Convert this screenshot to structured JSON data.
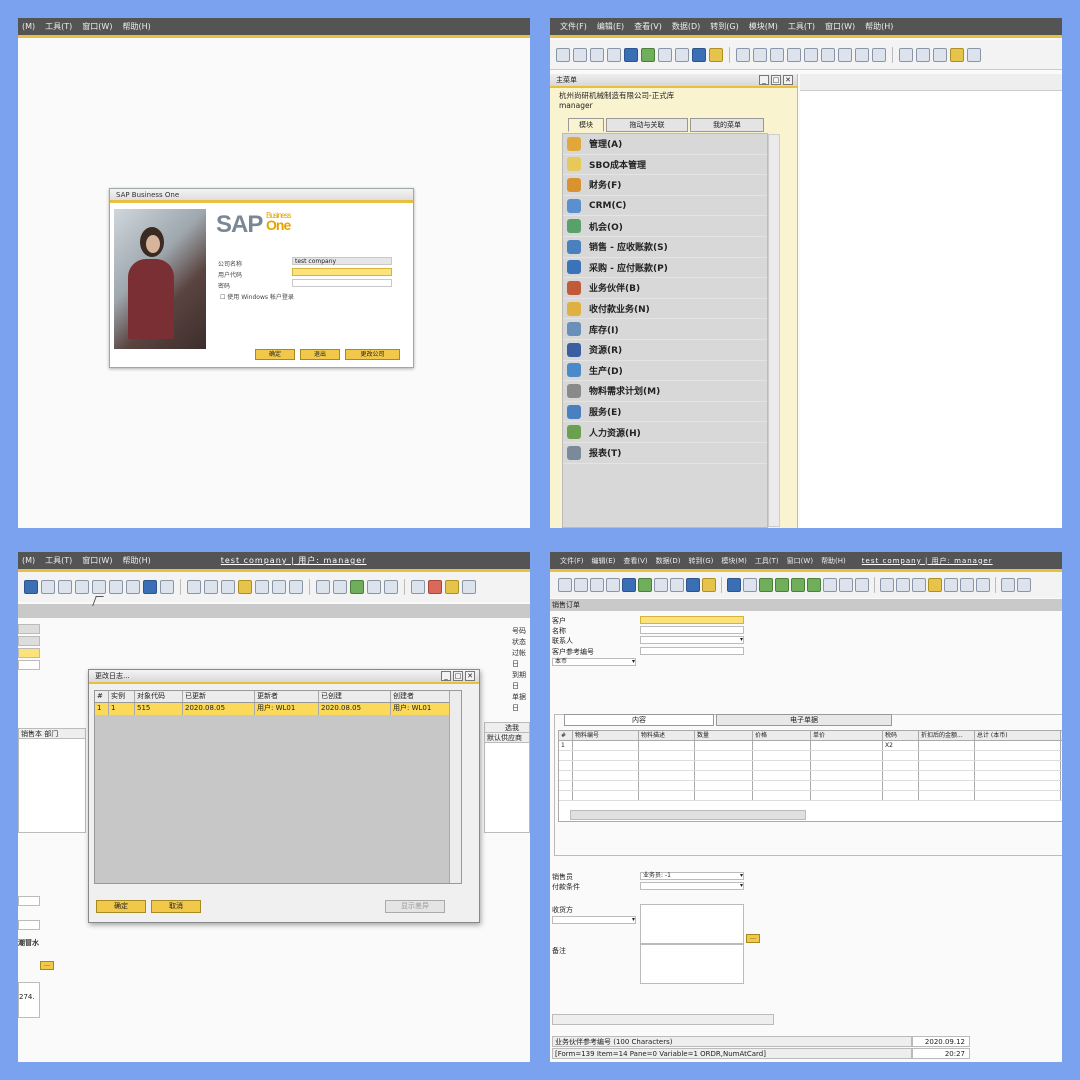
{
  "panel1": {
    "menu": [
      "(M)",
      "工具(T)",
      "窗口(W)",
      "帮助(H)"
    ],
    "login": {
      "window_title": "SAP Business One",
      "logo_sap": "SAP",
      "logo_business": "Business",
      "logo_one": "One",
      "company_label": "公司名称",
      "company_value": "test company",
      "user_label": "用户代码",
      "password_label": "密码",
      "windows_login": "使用 Windows 帐户登录",
      "ok_button": "确定",
      "exit_button": "退出",
      "change_company_button": "更改公司"
    }
  },
  "panel2": {
    "menu": [
      "文件(F)",
      "编辑(E)",
      "查看(V)",
      "数据(D)",
      "转到(G)",
      "模块(M)",
      "工具(T)",
      "窗口(W)",
      "帮助(H)"
    ],
    "main_menu": {
      "title": "主菜单",
      "company": "杭州尚研机械制造有限公司-正式库",
      "user": "manager",
      "tabs": [
        "模块",
        "拖动与关联",
        "我的菜单"
      ],
      "items": [
        {
          "label": "管理(A)",
          "icon": "admin-icon",
          "color": "#e0a73a"
        },
        {
          "label": "SBO成本管理",
          "icon": "cost-icon",
          "color": "#e8c85a"
        },
        {
          "label": "财务(F)",
          "icon": "finance-pie-icon",
          "color": "#d9922e"
        },
        {
          "label": "CRM(C)",
          "icon": "crm-icon",
          "color": "#5a8fd0"
        },
        {
          "label": "机会(O)",
          "icon": "opportunity-icon",
          "color": "#5aa06a"
        },
        {
          "label": "销售 - 应收账款(S)",
          "icon": "sales-icon",
          "color": "#4a7fc0"
        },
        {
          "label": "采购 - 应付账款(P)",
          "icon": "purchase-cart-icon",
          "color": "#3b73b8"
        },
        {
          "label": "业务伙伴(B)",
          "icon": "partners-icon",
          "color": "#c05a3a"
        },
        {
          "label": "收付款业务(N)",
          "icon": "payment-icon",
          "color": "#e0b040"
        },
        {
          "label": "库存(I)",
          "icon": "inventory-icon",
          "color": "#6a8fb8"
        },
        {
          "label": "资源(R)",
          "icon": "resources-icon",
          "color": "#3a5fa0"
        },
        {
          "label": "生产(D)",
          "icon": "production-icon",
          "color": "#4a8ac8"
        },
        {
          "label": "物料需求计划(M)",
          "icon": "mrp-icon",
          "color": "#8a8a8a"
        },
        {
          "label": "服务(E)",
          "icon": "service-icon",
          "color": "#4a80c0"
        },
        {
          "label": "人力资源(H)",
          "icon": "hr-icon",
          "color": "#6aa050"
        },
        {
          "label": "报表(T)",
          "icon": "reports-icon",
          "color": "#7a8a9a"
        }
      ]
    }
  },
  "panel3": {
    "menu": [
      "(M)",
      "工具(T)",
      "窗口(W)",
      "帮助(H)"
    ],
    "userbar": "test company | 用户: manager",
    "right_labels": [
      "号码",
      "状态",
      "过帐日",
      "到期日",
      "单据日"
    ],
    "left_col_header": "销售本 部门",
    "right_col_header": "选我",
    "right_col_header2": "默认供应商",
    "detail_label": "潮冒水",
    "number_fragment": "274.",
    "dialog": {
      "title": "更改日志...",
      "columns": [
        "#",
        "实例",
        "对象代码",
        "已更新",
        "更新者",
        "已创建",
        "创建者"
      ],
      "row": [
        "1",
        "1",
        "515",
        "2020.08.05",
        "用户: WL01",
        "2020.08.05",
        "用户: WL01"
      ],
      "ok_button": "确定",
      "cancel_button": "取消",
      "show_diff_button": "显示差异"
    }
  },
  "panel4": {
    "menu": [
      "文件(F)",
      "编辑(E)",
      "查看(V)",
      "数据(D)",
      "转到(G)",
      "模块(M)",
      "工具(T)",
      "窗口(W)",
      "帮助(H)"
    ],
    "userbar": "test company | 用户: manager",
    "form_title": "销售订单",
    "labels": [
      "客户",
      "名称",
      "联系人",
      "客户参考编号",
      "本币"
    ],
    "tabs": [
      "内容",
      "电子单据"
    ],
    "columns": [
      "#",
      "物料编号",
      "物料描述",
      "数量",
      "价格",
      "单价",
      "税码",
      "折扣后的金额...",
      "总计 (本币)"
    ],
    "row1": [
      "1",
      "",
      "",
      "",
      "",
      "",
      "X2",
      "",
      ""
    ],
    "sales_employee_label": "销售员",
    "sales_employee_value": "业务员: -1",
    "payment_terms_label": "付款条件",
    "ship_to_label": "收货方",
    "remarks_label": "备注",
    "status_bp_ref": "业务伙伴参考编号 (100 Characters)",
    "status_date": "2020.09.12",
    "status_form": "[Form=139 Item=14 Pane=0 Variable=1 ORDR,NumAtCard]",
    "status_time": "20:27"
  }
}
